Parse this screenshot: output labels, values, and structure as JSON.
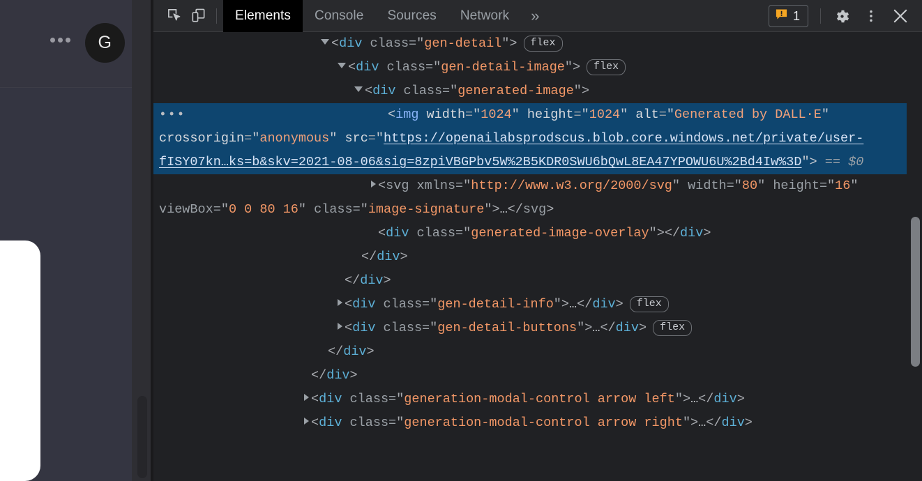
{
  "page": {
    "avatar_letter": "G",
    "menu_icon": "more-horizontal-icon",
    "card_label": ""
  },
  "devtools": {
    "toolbar": {
      "inspect_icon": "inspect-element-icon",
      "device_icon": "device-toolbar-icon",
      "tabs": [
        {
          "label": "Elements",
          "active": true
        },
        {
          "label": "Console",
          "active": false
        },
        {
          "label": "Sources",
          "active": false
        },
        {
          "label": "Network",
          "active": false
        }
      ],
      "more_tabs_label": "»",
      "warnings": {
        "icon": "warning-message-icon",
        "count": "1",
        "color": "#f5a623"
      },
      "settings_icon": "gear-icon",
      "menu_icon": "more-vertical-icon",
      "close_icon": "close-icon"
    },
    "dom_tree": {
      "rows": [
        {
          "id": "row-gen-detail",
          "indent": 232,
          "marker": "open",
          "selected": false,
          "parts": [
            {
              "t": "punct",
              "v": "<"
            },
            {
              "t": "tag",
              "v": "div"
            },
            {
              "t": "space",
              "v": " "
            },
            {
              "t": "attr-name",
              "v": "class"
            },
            {
              "t": "eq",
              "v": "="
            },
            {
              "t": "punct",
              "v": "\""
            },
            {
              "t": "attr-value",
              "v": "gen-detail"
            },
            {
              "t": "punct",
              "v": "\">"
            }
          ],
          "badge": "flex"
        },
        {
          "id": "row-gen-detail-image",
          "indent": 256,
          "marker": "open",
          "selected": false,
          "parts": [
            {
              "t": "punct",
              "v": "<"
            },
            {
              "t": "tag",
              "v": "div"
            },
            {
              "t": "space",
              "v": " "
            },
            {
              "t": "attr-name",
              "v": "class"
            },
            {
              "t": "eq",
              "v": "="
            },
            {
              "t": "punct",
              "v": "\""
            },
            {
              "t": "attr-value",
              "v": "gen-detail-image"
            },
            {
              "t": "punct",
              "v": "\">"
            }
          ],
          "badge": "flex"
        },
        {
          "id": "row-generated-image",
          "indent": 280,
          "marker": "open",
          "selected": false,
          "parts": [
            {
              "t": "punct",
              "v": "<"
            },
            {
              "t": "tag",
              "v": "div"
            },
            {
              "t": "space",
              "v": " "
            },
            {
              "t": "attr-name",
              "v": "class"
            },
            {
              "t": "eq",
              "v": "="
            },
            {
              "t": "punct",
              "v": "\""
            },
            {
              "t": "attr-value",
              "v": "generated-image"
            },
            {
              "t": "punct",
              "v": "\">"
            }
          ],
          "badge": null
        },
        {
          "id": "row-img-selected",
          "indent": 318,
          "marker": "none",
          "selected": true,
          "row_ellipsis": "•••",
          "parts": [
            {
              "t": "punct",
              "v": "<"
            },
            {
              "t": "tag",
              "v": "img"
            },
            {
              "t": "space",
              "v": " "
            },
            {
              "t": "attr-name",
              "v": "width"
            },
            {
              "t": "eq",
              "v": "="
            },
            {
              "t": "punct",
              "v": "\""
            },
            {
              "t": "attr-value",
              "v": "1024"
            },
            {
              "t": "punct",
              "v": "\""
            },
            {
              "t": "space",
              "v": " "
            },
            {
              "t": "attr-name",
              "v": "height"
            },
            {
              "t": "eq",
              "v": "="
            },
            {
              "t": "punct",
              "v": "\""
            },
            {
              "t": "attr-value",
              "v": "1024"
            },
            {
              "t": "punct",
              "v": "\""
            },
            {
              "t": "space",
              "v": " "
            },
            {
              "t": "attr-name",
              "v": "alt"
            },
            {
              "t": "eq",
              "v": "="
            },
            {
              "t": "punct",
              "v": "\""
            },
            {
              "t": "attr-value",
              "v": "Generated by DALL·E"
            },
            {
              "t": "punct",
              "v": "\""
            },
            {
              "t": "space",
              "v": " "
            },
            {
              "t": "attr-name",
              "v": "crossorigin"
            },
            {
              "t": "eq",
              "v": "="
            },
            {
              "t": "punct",
              "v": "\""
            },
            {
              "t": "attr-value",
              "v": "anonymous"
            },
            {
              "t": "punct",
              "v": "\""
            },
            {
              "t": "space",
              "v": " "
            },
            {
              "t": "attr-name",
              "v": "src"
            },
            {
              "t": "eq",
              "v": "="
            },
            {
              "t": "punct",
              "v": "\""
            },
            {
              "t": "link",
              "v": "https://openailabsprodscus.blob.core.windows.net/private/user-fISY07kn…ks=b&skv=2021-08-06&sig=8zpiVBGPbv5W%2B5KDR0SWU6bQwL8EA47YPOWU6U%2Bd4Iw%3D"
            },
            {
              "t": "punct",
              "v": "\">"
            },
            {
              "t": "space",
              "v": " "
            },
            {
              "t": "eq",
              "v": "=="
            },
            {
              "t": "space",
              "v": " "
            },
            {
              "t": "dollar",
              "v": "$0"
            }
          ],
          "badge": null
        },
        {
          "id": "row-svg-signature",
          "indent": 304,
          "marker": "closed",
          "selected": false,
          "parts": [
            {
              "t": "punct",
              "v": "<"
            },
            {
              "t": "svgtag",
              "v": "svg"
            },
            {
              "t": "space",
              "v": " "
            },
            {
              "t": "attr-name",
              "v": "xmlns"
            },
            {
              "t": "eq",
              "v": "="
            },
            {
              "t": "punct",
              "v": "\""
            },
            {
              "t": "attr-value",
              "v": "http://www.w3.org/2000/svg"
            },
            {
              "t": "punct",
              "v": "\""
            },
            {
              "t": "space",
              "v": " "
            },
            {
              "t": "attr-name",
              "v": "width"
            },
            {
              "t": "eq",
              "v": "="
            },
            {
              "t": "punct",
              "v": "\""
            },
            {
              "t": "attr-value",
              "v": "80"
            },
            {
              "t": "punct",
              "v": "\""
            },
            {
              "t": "space",
              "v": " "
            },
            {
              "t": "attr-name",
              "v": "height"
            },
            {
              "t": "eq",
              "v": "="
            },
            {
              "t": "punct",
              "v": "\""
            },
            {
              "t": "attr-value",
              "v": "16"
            },
            {
              "t": "punct",
              "v": "\""
            },
            {
              "t": "space",
              "v": " "
            },
            {
              "t": "attr-name",
              "v": "viewBox"
            },
            {
              "t": "eq",
              "v": "="
            },
            {
              "t": "punct",
              "v": "\""
            },
            {
              "t": "attr-value",
              "v": "0 0 80 16"
            },
            {
              "t": "punct",
              "v": "\""
            },
            {
              "t": "space",
              "v": " "
            },
            {
              "t": "attr-name",
              "v": "class"
            },
            {
              "t": "eq",
              "v": "="
            },
            {
              "t": "punct",
              "v": "\""
            },
            {
              "t": "attr-value",
              "v": "image-signature"
            },
            {
              "t": "punct",
              "v": "\">"
            },
            {
              "t": "ellip",
              "v": "…"
            },
            {
              "t": "punct",
              "v": "</"
            },
            {
              "t": "svgtag",
              "v": "svg"
            },
            {
              "t": "punct",
              "v": ">"
            }
          ],
          "badge": null
        },
        {
          "id": "row-generated-image-overlay",
          "indent": 304,
          "marker": "none",
          "selected": false,
          "parts": [
            {
              "t": "punct",
              "v": "<"
            },
            {
              "t": "tag",
              "v": "div"
            },
            {
              "t": "space",
              "v": " "
            },
            {
              "t": "attr-name",
              "v": "class"
            },
            {
              "t": "eq",
              "v": "="
            },
            {
              "t": "punct",
              "v": "\""
            },
            {
              "t": "attr-value",
              "v": "generated-image-overlay"
            },
            {
              "t": "punct",
              "v": "\"></"
            },
            {
              "t": "tag",
              "v": "div"
            },
            {
              "t": "punct",
              "v": ">"
            }
          ],
          "badge": null
        },
        {
          "id": "row-close-generated-image",
          "indent": 280,
          "marker": "none",
          "selected": false,
          "parts": [
            {
              "t": "punct",
              "v": "</"
            },
            {
              "t": "tag",
              "v": "div"
            },
            {
              "t": "punct",
              "v": ">"
            }
          ],
          "badge": null
        },
        {
          "id": "row-close-gen-detail-image",
          "indent": 256,
          "marker": "none",
          "selected": false,
          "parts": [
            {
              "t": "punct",
              "v": "</"
            },
            {
              "t": "tag",
              "v": "div"
            },
            {
              "t": "punct",
              "v": ">"
            }
          ],
          "badge": null
        },
        {
          "id": "row-gen-detail-info",
          "indent": 256,
          "marker": "closed",
          "selected": false,
          "parts": [
            {
              "t": "punct",
              "v": "<"
            },
            {
              "t": "tag",
              "v": "div"
            },
            {
              "t": "space",
              "v": " "
            },
            {
              "t": "attr-name",
              "v": "class"
            },
            {
              "t": "eq",
              "v": "="
            },
            {
              "t": "punct",
              "v": "\""
            },
            {
              "t": "attr-value",
              "v": "gen-detail-info"
            },
            {
              "t": "punct",
              "v": "\">"
            },
            {
              "t": "ellip",
              "v": "…"
            },
            {
              "t": "punct",
              "v": "</"
            },
            {
              "t": "tag",
              "v": "div"
            },
            {
              "t": "punct",
              "v": ">"
            }
          ],
          "badge": "flex"
        },
        {
          "id": "row-gen-detail-buttons",
          "indent": 256,
          "marker": "closed",
          "selected": false,
          "parts": [
            {
              "t": "punct",
              "v": "<"
            },
            {
              "t": "tag",
              "v": "div"
            },
            {
              "t": "space",
              "v": " "
            },
            {
              "t": "attr-name",
              "v": "class"
            },
            {
              "t": "eq",
              "v": "="
            },
            {
              "t": "punct",
              "v": "\""
            },
            {
              "t": "attr-value",
              "v": "gen-detail-buttons"
            },
            {
              "t": "punct",
              "v": "\">"
            },
            {
              "t": "ellip",
              "v": "…"
            },
            {
              "t": "punct",
              "v": "</"
            },
            {
              "t": "tag",
              "v": "div"
            },
            {
              "t": "punct",
              "v": ">"
            }
          ],
          "badge": "flex"
        },
        {
          "id": "row-close-gen-detail",
          "indent": 232,
          "marker": "none",
          "selected": false,
          "parts": [
            {
              "t": "punct",
              "v": "</"
            },
            {
              "t": "tag",
              "v": "div"
            },
            {
              "t": "punct",
              "v": ">"
            }
          ],
          "badge": null
        },
        {
          "id": "row-close-outer",
          "indent": 208,
          "marker": "none",
          "selected": false,
          "parts": [
            {
              "t": "punct",
              "v": "</"
            },
            {
              "t": "tag",
              "v": "div"
            },
            {
              "t": "punct",
              "v": ">"
            }
          ],
          "badge": null
        },
        {
          "id": "row-modal-control-left",
          "indent": 208,
          "marker": "closed",
          "selected": false,
          "parts": [
            {
              "t": "punct",
              "v": "<"
            },
            {
              "t": "tag",
              "v": "div"
            },
            {
              "t": "space",
              "v": " "
            },
            {
              "t": "attr-name",
              "v": "class"
            },
            {
              "t": "eq",
              "v": "="
            },
            {
              "t": "punct",
              "v": "\""
            },
            {
              "t": "attr-value",
              "v": "generation-modal-control arrow left"
            },
            {
              "t": "punct",
              "v": "\">"
            },
            {
              "t": "ellip",
              "v": "…"
            },
            {
              "t": "punct",
              "v": "</"
            },
            {
              "t": "tag",
              "v": "div"
            },
            {
              "t": "punct",
              "v": ">"
            }
          ],
          "badge": null
        },
        {
          "id": "row-modal-control-right",
          "indent": 208,
          "marker": "closed",
          "selected": false,
          "parts": [
            {
              "t": "punct",
              "v": "<"
            },
            {
              "t": "tag",
              "v": "div"
            },
            {
              "t": "space",
              "v": " "
            },
            {
              "t": "attr-name",
              "v": "class"
            },
            {
              "t": "eq",
              "v": "="
            },
            {
              "t": "punct",
              "v": "\""
            },
            {
              "t": "attr-value",
              "v": "generation-modal-control arrow right"
            },
            {
              "t": "punct",
              "v": "\">"
            },
            {
              "t": "ellip",
              "v": "…"
            },
            {
              "t": "punct",
              "v": "</"
            },
            {
              "t": "tag",
              "v": "div"
            },
            {
              "t": "punct",
              "v": ">"
            }
          ],
          "badge": null
        }
      ]
    }
  }
}
